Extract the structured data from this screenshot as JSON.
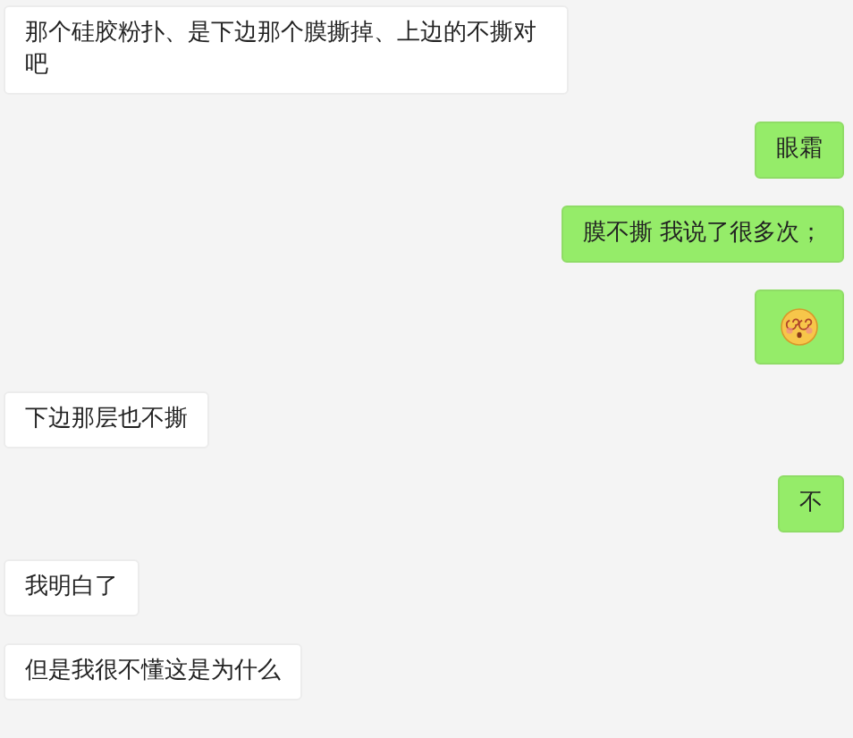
{
  "messages": [
    {
      "outgoing": false,
      "kind": "text",
      "text": "那个硅胶粉扑、是下边那个膜撕掉、上边的不撕对吧"
    },
    {
      "outgoing": true,
      "kind": "text",
      "text": "眼霜"
    },
    {
      "outgoing": true,
      "kind": "text",
      "text": "膜不撕 我说了很多次；"
    },
    {
      "outgoing": true,
      "kind": "sticker"
    },
    {
      "outgoing": false,
      "kind": "text",
      "text": "下边那层也不撕"
    },
    {
      "outgoing": true,
      "kind": "text",
      "text": "不"
    },
    {
      "outgoing": false,
      "kind": "text",
      "text": "我明白了"
    },
    {
      "outgoing": false,
      "kind": "text",
      "text": "但是我很不懂这是为什么"
    }
  ]
}
